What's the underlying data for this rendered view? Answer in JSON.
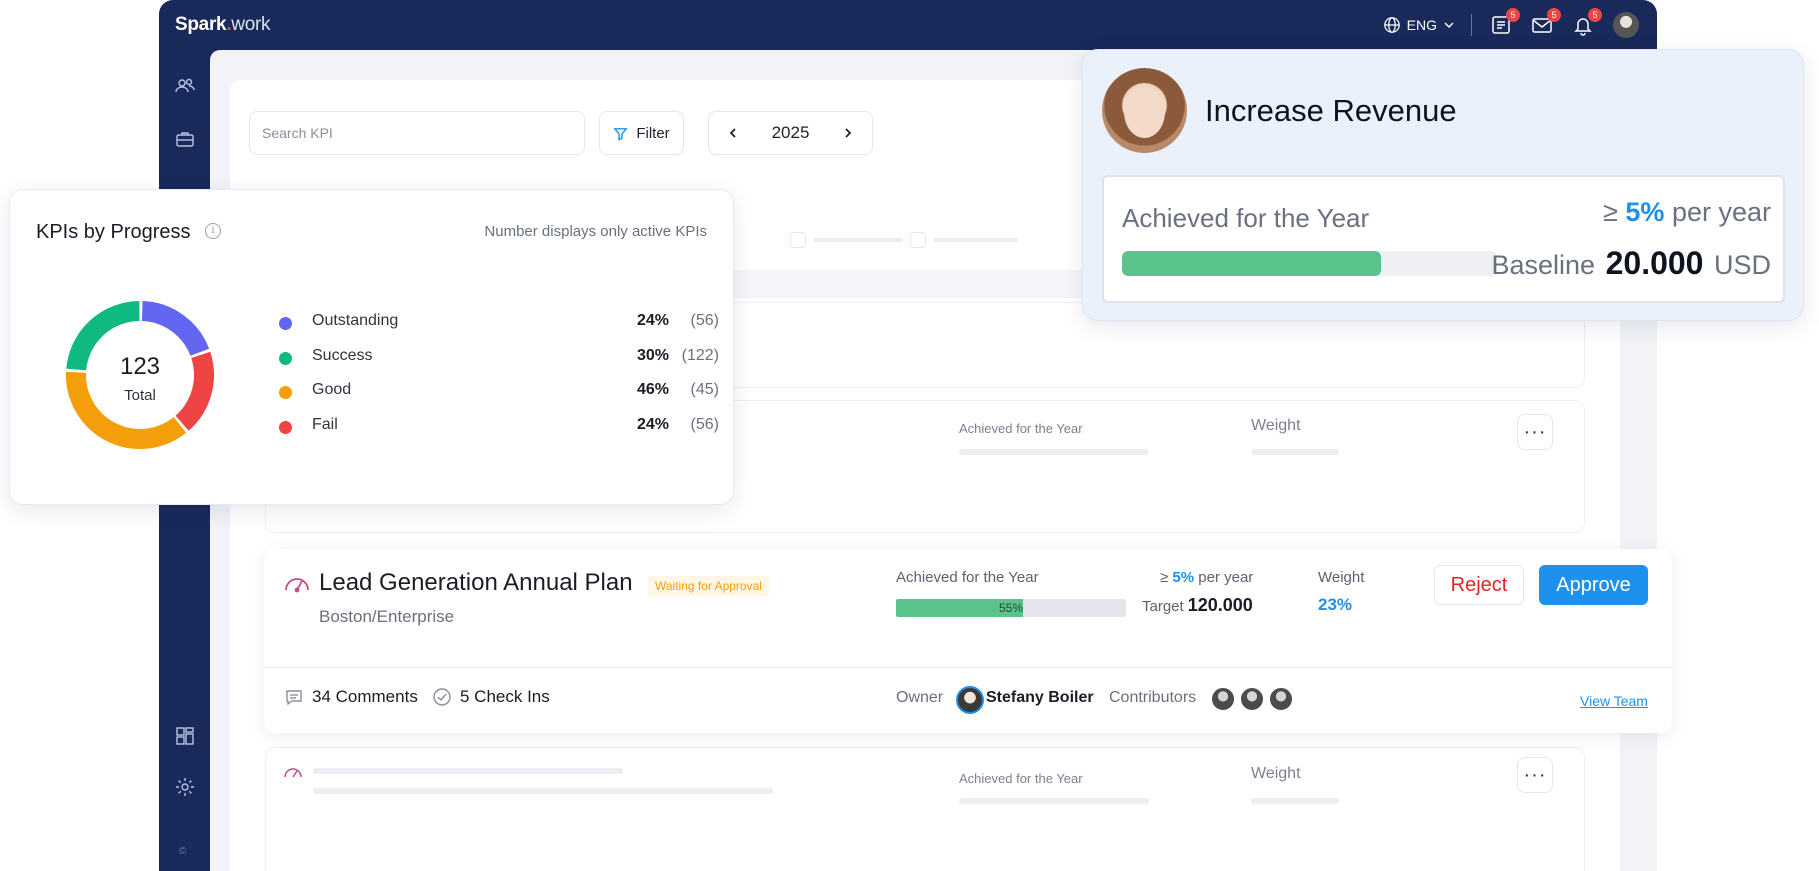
{
  "app": {
    "brand_main": "Spark",
    "brand_dot": ".",
    "brand_rest": "work",
    "language": "ENG",
    "badges": {
      "tasks": "5",
      "messages": "5",
      "notifications": "5"
    }
  },
  "toolbar": {
    "search_placeholder": "Search KPI",
    "filter_label": "Filter",
    "year": "2025"
  },
  "ghost_rows": {
    "achieved_label": "Achieved for the Year",
    "weight_label": "Weight"
  },
  "kpi": {
    "title": "Lead Generation Annual Plan",
    "status": "Waiting for Approval",
    "subtitle": "Boston/Enterprise",
    "achieved_label": "Achieved for the Year",
    "progress_text": "55%",
    "progress_fraction": 0.55,
    "goal_symbol": "≥",
    "goal_value": "5%",
    "goal_suffix": "per year",
    "target_label": "Target",
    "target_value": "120.000",
    "weight_label": "Weight",
    "weight_value": "23%",
    "reject_label": "Reject",
    "approve_label": "Approve",
    "comments": "34 Comments",
    "checkins": "5 Check Ins",
    "owner_label": "Owner",
    "owner_name": "Stefany Boiler",
    "contributors_label": "Contributors",
    "view_team_label": "View Team"
  },
  "progress_card": {
    "title": "KPIs by Progress",
    "note": "Number displays only active KPIs",
    "total_value": "123",
    "total_label": "Total",
    "items": [
      {
        "name": "Outstanding",
        "pct": "24%",
        "count": "(56)",
        "color": "#6366f1"
      },
      {
        "name": "Success",
        "pct": "30%",
        "count": "(122)",
        "color": "#10b981"
      },
      {
        "name": "Good",
        "pct": "46%",
        "count": "(45)",
        "color": "#f59e0b"
      },
      {
        "name": "Fail",
        "pct": "24%",
        "count": "(56)",
        "color": "#ef4444"
      }
    ]
  },
  "revenue_card": {
    "title": "Increase Revenue",
    "achieved_label": "Achieved for the Year",
    "goal_symbol": "≥",
    "goal_value": "5%",
    "goal_suffix": "per year",
    "progress_fraction": 0.69,
    "baseline_label": "Baseline",
    "baseline_value": "20.000",
    "baseline_unit": "USD"
  },
  "colors": {
    "nav_bg": "#18295a",
    "accent_blue": "#1e90ee",
    "success_green": "#5ac28b",
    "reject_red": "#dc2626",
    "warning_orange": "#f59e0b"
  }
}
